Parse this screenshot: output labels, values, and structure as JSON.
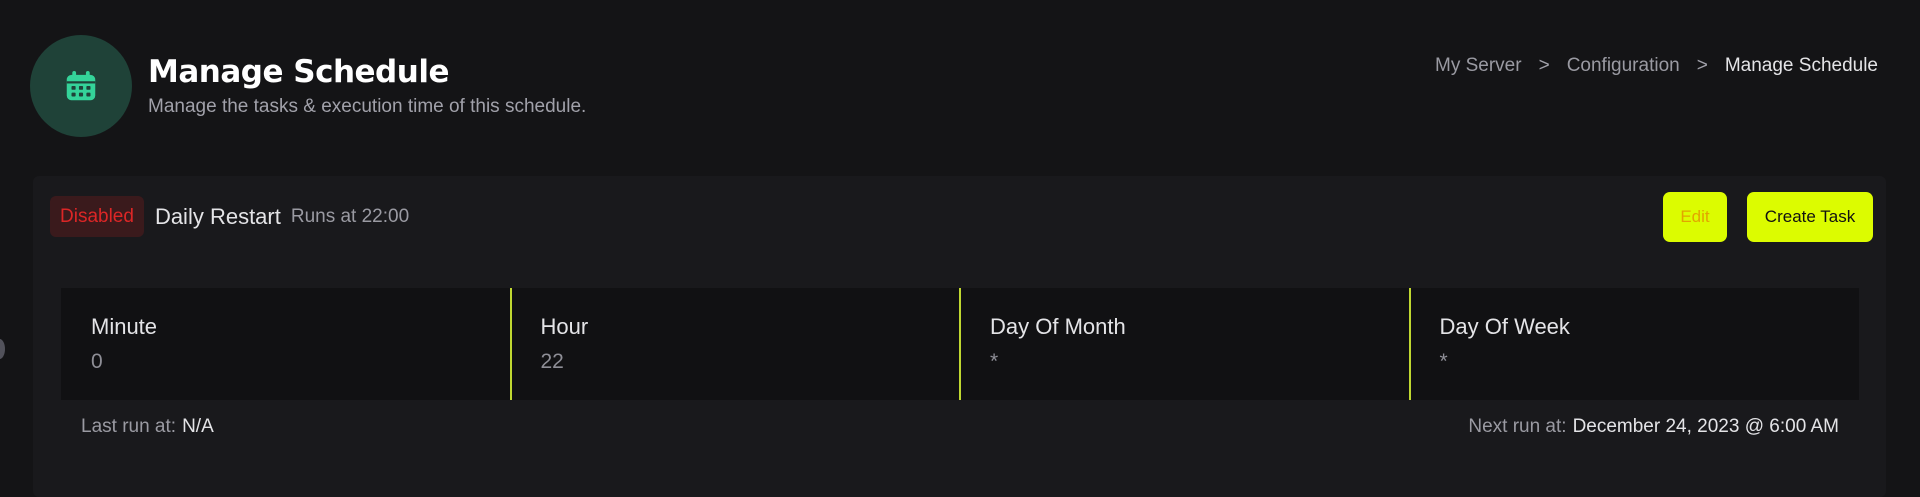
{
  "header": {
    "icon": "calendar-icon",
    "title": "Manage Schedule",
    "subtitle": "Manage the tasks & execution time of this schedule."
  },
  "breadcrumb": {
    "items": [
      "My Server",
      "Configuration",
      "Manage Schedule"
    ],
    "separator": ">"
  },
  "schedule": {
    "status": "Disabled",
    "name": "Daily Restart",
    "runs": "Runs at 22:00",
    "edit_label": "Edit",
    "create_task_label": "Create Task"
  },
  "cron": [
    {
      "label": "Minute",
      "value": "0"
    },
    {
      "label": "Hour",
      "value": "22"
    },
    {
      "label": "Day Of Month",
      "value": "*"
    },
    {
      "label": "Day Of Week",
      "value": "*"
    }
  ],
  "footer": {
    "last_run_label": "Last run at:",
    "last_run_value": "N/A",
    "next_run_label": "Next run at:",
    "next_run_value": "December 24, 2023 @ 6:00 AM"
  },
  "colors": {
    "background": "#141416",
    "card": "#19191c",
    "accent": "#dcfc00",
    "icon_circle": "#1f4238",
    "icon": "#34d399",
    "disabled_badge_bg": "#3a1a1c",
    "disabled_badge_text": "#dc2626",
    "divider": "#c0d831"
  }
}
